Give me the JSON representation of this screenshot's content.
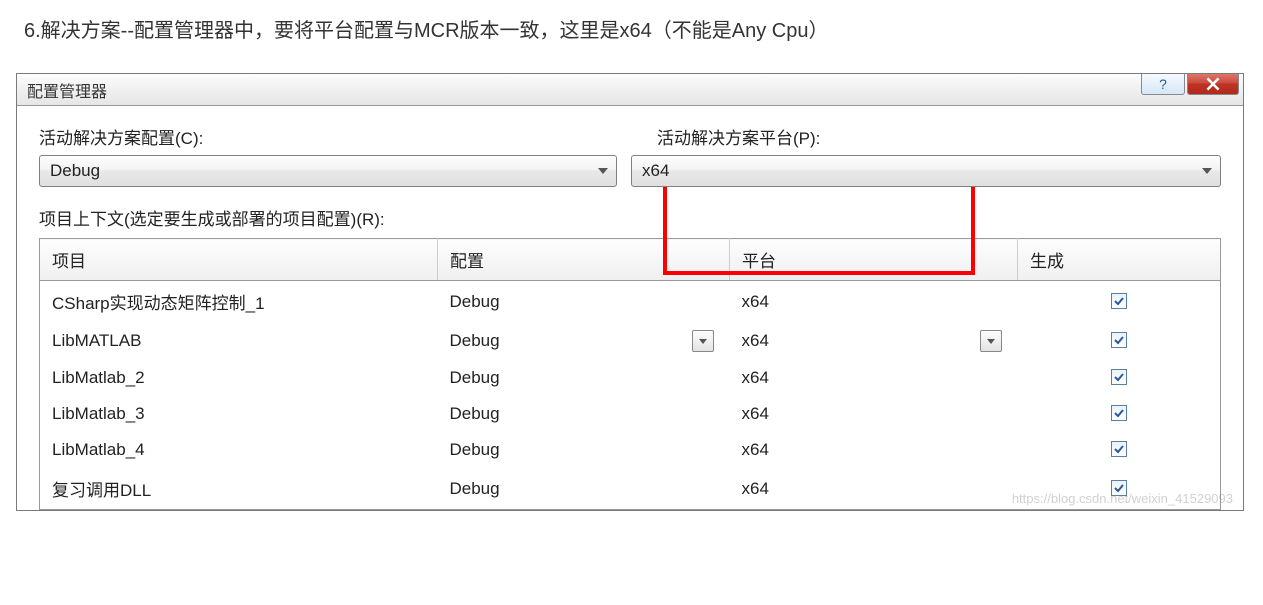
{
  "instruction": "6.解决方案--配置管理器中，要将平台配置与MCR版本一致，这里是x64（不能是Any Cpu）",
  "dialog": {
    "title": "配置管理器",
    "help_symbol": "?",
    "labels": {
      "active_config": "活动解决方案配置(C):",
      "active_platform": "活动解决方案平台(P):",
      "context": "项目上下文(选定要生成或部署的项目配置)(R):"
    },
    "combos": {
      "config_value": "Debug",
      "platform_value": "x64"
    },
    "table": {
      "headers": {
        "project": "项目",
        "config": "配置",
        "platform": "平台",
        "build": "生成"
      },
      "rows": [
        {
          "project": "CSharp实现动态矩阵控制_1",
          "config": "Debug",
          "platform": "x64",
          "build": true,
          "showDropdown": false
        },
        {
          "project": "LibMATLAB",
          "config": "Debug",
          "platform": "x64",
          "build": true,
          "showDropdown": true
        },
        {
          "project": "LibMatlab_2",
          "config": "Debug",
          "platform": "x64",
          "build": true,
          "showDropdown": false
        },
        {
          "project": "LibMatlab_3",
          "config": "Debug",
          "platform": "x64",
          "build": true,
          "showDropdown": false
        },
        {
          "project": "LibMatlab_4",
          "config": "Debug",
          "platform": "x64",
          "build": true,
          "showDropdown": false
        },
        {
          "project": "复习调用DLL",
          "config": "Debug",
          "platform": "x64",
          "build": true,
          "showDropdown": false
        }
      ]
    }
  },
  "watermark": "https://blog.csdn.net/weixin_41529093"
}
